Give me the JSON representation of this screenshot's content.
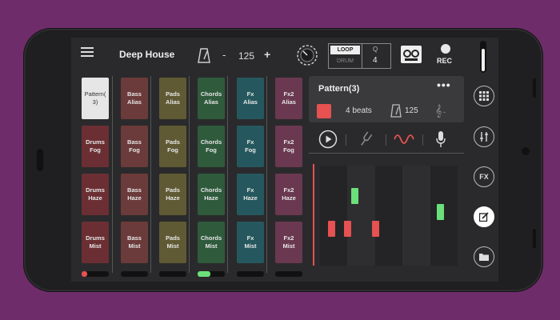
{
  "header": {
    "title": "Deep House",
    "bpm_minus": "-",
    "bpm": "125",
    "bpm_plus": "+",
    "loop_label": "LOOP",
    "drum_label": "DRUM",
    "q_label": "Q",
    "q_value": "4",
    "rec_label": "REC"
  },
  "pads": [
    [
      {
        "label": "Pattern(\n3)",
        "color": "#e6e6e6",
        "selected": true
      },
      {
        "label": "Drums\nFog",
        "color": "#6b2f33"
      },
      {
        "label": "Drums\nHaze",
        "color": "#6b2f33"
      },
      {
        "label": "Drums\nMist",
        "color": "#6b2f33"
      }
    ],
    [
      {
        "label": "Bass\nAlias",
        "color": "#6b3a3a"
      },
      {
        "label": "Bass\nFog",
        "color": "#6b3a3a"
      },
      {
        "label": "Bass\nHaze",
        "color": "#6b3a3a"
      },
      {
        "label": "Bass\nMist",
        "color": "#6b3a3a"
      }
    ],
    [
      {
        "label": "Pads\nAlias",
        "color": "#5f5a34"
      },
      {
        "label": "Pads\nFog",
        "color": "#5f5a34"
      },
      {
        "label": "Pads\nHaze",
        "color": "#5f5a34"
      },
      {
        "label": "Pads\nMist",
        "color": "#5f5a34"
      }
    ],
    [
      {
        "label": "Chords\nAlias",
        "color": "#2f5a3c"
      },
      {
        "label": "Chords\nFog",
        "color": "#2f5a3c"
      },
      {
        "label": "Chords\nHaze",
        "color": "#2f5a3c"
      },
      {
        "label": "Chords\nMist",
        "color": "#2f5a3c"
      }
    ],
    [
      {
        "label": "Fx\nAlias",
        "color": "#25585e"
      },
      {
        "label": "Fx\nFog",
        "color": "#25585e"
      },
      {
        "label": "Fx\nHaze",
        "color": "#25585e"
      },
      {
        "label": "Fx\nMist",
        "color": "#25585e"
      }
    ],
    [
      {
        "label": "Fx2\nAlias",
        "color": "#6a3850"
      },
      {
        "label": "Fx2\nFog",
        "color": "#6a3850"
      },
      {
        "label": "Fx2\nHaze",
        "color": "#6a3850"
      },
      {
        "label": "Fx2\nMist",
        "color": "#6a3850"
      }
    ]
  ],
  "meters": [
    {
      "dot_color": "#e65151"
    },
    {
      "dot_color": ""
    },
    {
      "dot_color": ""
    },
    {
      "dot_color": "#6be07a"
    },
    {
      "dot_color": ""
    },
    {
      "dot_color": ""
    }
  ],
  "pattern": {
    "title": "Pattern(3)",
    "more": "•••",
    "beats": "4 beats",
    "bpm": "125",
    "key_value": "-",
    "color": "#e65151"
  },
  "piano_roll": {
    "notes": [
      {
        "beat": 0.4,
        "row": 0.55,
        "color": "#e65151"
      },
      {
        "beat": 1.0,
        "row": 0.55,
        "color": "#e65151"
      },
      {
        "beat": 2.0,
        "row": 0.55,
        "color": "#e65151"
      },
      {
        "beat": 1.25,
        "row": 0.22,
        "color": "#6be07a"
      },
      {
        "beat": 4.35,
        "row": 0.38,
        "color": "#6be07a"
      }
    ]
  },
  "icons": {
    "menu": "hamburger-icon",
    "metronome": "metronome-icon",
    "dial": "dial-icon",
    "tape": "tape-icon",
    "rec": "record-icon",
    "play": "play-icon",
    "tuning_fork": "tuning-fork-icon",
    "wave": "wave-icon",
    "mic": "microphone-icon",
    "grid": "grid-icon",
    "mixer": "mixer-icon",
    "fx": "FX",
    "edit": "edit-icon",
    "folder": "folder-icon"
  }
}
